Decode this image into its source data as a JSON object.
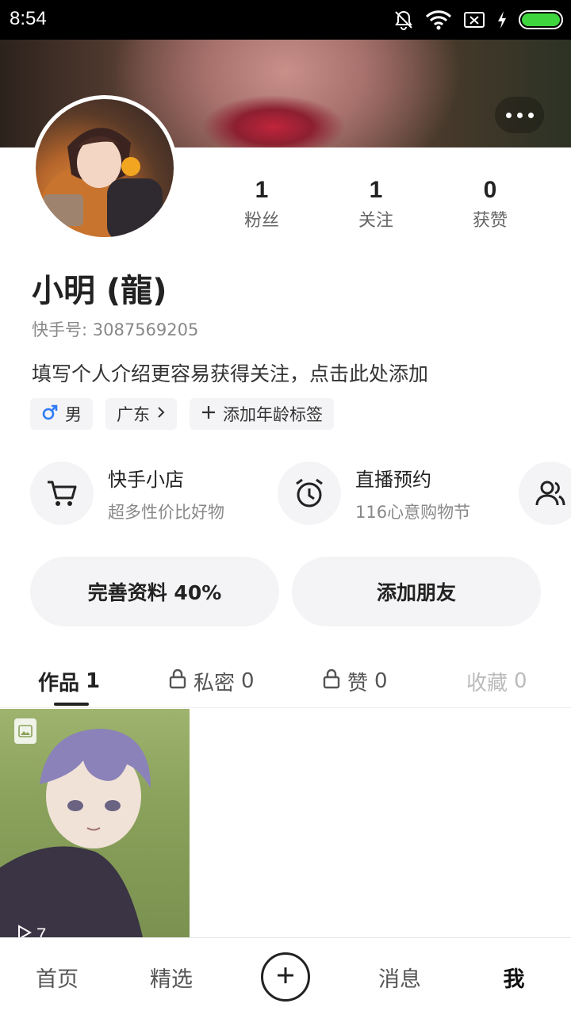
{
  "status_bar": {
    "time": "8:54"
  },
  "profile": {
    "name": "小明 (龍)",
    "kuaishou_id": "快手号: 3087569205",
    "bio_prompt": "填写个人介绍更容易获得关注，点击此处添加",
    "stats": [
      {
        "value": "1",
        "label": "粉丝"
      },
      {
        "value": "1",
        "label": "关注"
      },
      {
        "value": "0",
        "label": "获赞"
      }
    ],
    "tags": {
      "gender": "男",
      "region": "广东",
      "add_age": "添加年龄标签"
    }
  },
  "shortcuts": [
    {
      "title": "快手小店",
      "subtitle": "超多性价比好物",
      "icon": "cart-icon"
    },
    {
      "title": "直播预约",
      "subtitle": "116心意购物节",
      "icon": "alarm-clock-icon"
    },
    {
      "title": "",
      "subtitle": "",
      "icon": "friends-icon"
    }
  ],
  "actions": {
    "complete_profile": "完善资料 40%",
    "add_friends": "添加朋友"
  },
  "tabs": [
    {
      "label": "作品",
      "count": "1"
    },
    {
      "label": "私密",
      "count": "0"
    },
    {
      "label": "赞",
      "count": "0"
    },
    {
      "label": "收藏",
      "count": "0"
    }
  ],
  "works": [
    {
      "play_count": "7"
    }
  ],
  "bottom_nav": {
    "home": "首页",
    "featured": "精选",
    "messages": "消息",
    "me": "我"
  },
  "colors": {
    "battery": "#3ed43e",
    "gender_icon": "#2f7bf5",
    "tab_underline": "#222222"
  }
}
